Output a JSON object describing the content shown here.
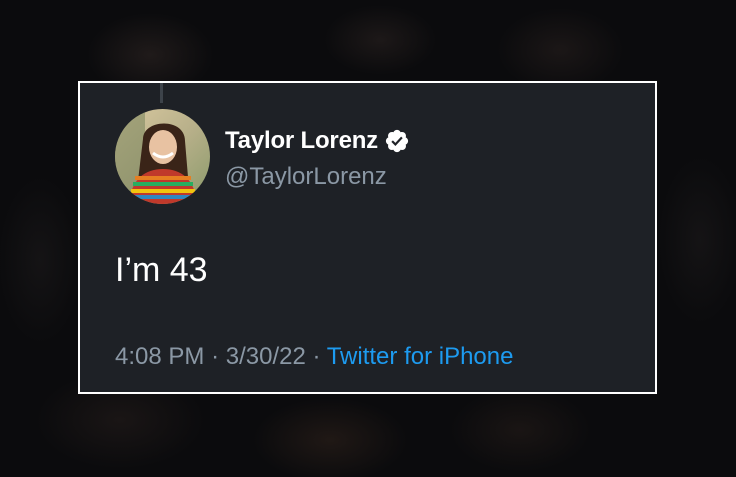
{
  "tweet": {
    "display_name": "Taylor Lorenz",
    "handle": "@TaylorLorenz",
    "text": "I’m 43",
    "time": "4:08 PM",
    "separator": "·",
    "date": "3/30/22",
    "source": "Twitter for iPhone",
    "verified_icon": "verified-badge-icon"
  },
  "colors": {
    "card_background": "#1e2126",
    "card_border": "#ffffff",
    "text_primary": "#ffffff",
    "text_secondary": "#8b98a5",
    "link": "#1d9bf0"
  }
}
